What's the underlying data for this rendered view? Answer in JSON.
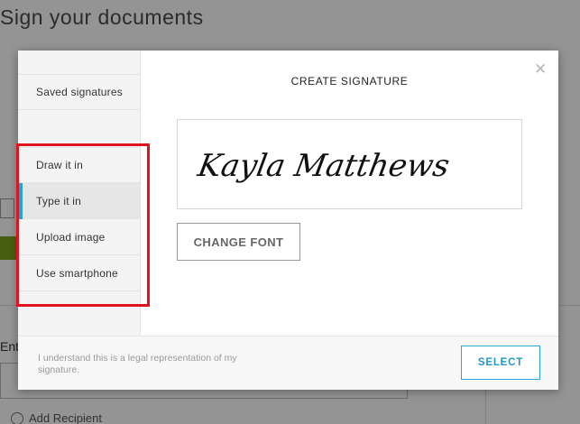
{
  "background": {
    "title": "Sign your documents",
    "enter_label": "Ent",
    "add_recipient": "Add Recipient"
  },
  "modal": {
    "title": "CREATE SIGNATURE",
    "close_icon": "close-icon",
    "sidebar": {
      "saved": "Saved signatures",
      "items": [
        {
          "label": "Draw it in",
          "active": false
        },
        {
          "label": "Type it in",
          "active": true
        },
        {
          "label": "Upload image",
          "active": false
        },
        {
          "label": "Use smartphone",
          "active": false
        }
      ]
    },
    "signature_text": "Kayla Matthews",
    "change_font_label": "CHANGE FONT",
    "legal_text": "I understand this is a legal representation of my signature.",
    "select_label": "SELECT"
  },
  "colors": {
    "accent": "#1aa6d9",
    "highlight": "#e0141e",
    "bg_green": "#7aa21c"
  }
}
